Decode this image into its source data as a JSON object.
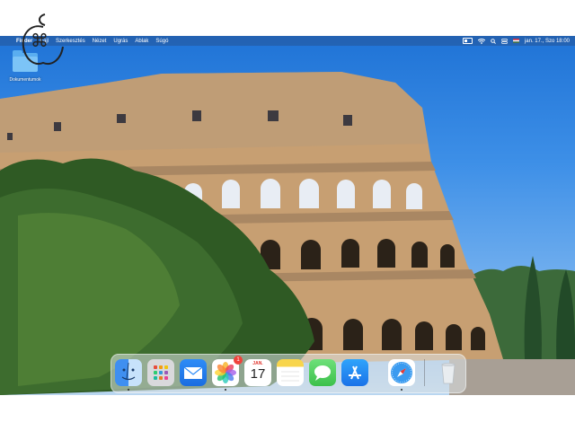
{
  "menubar": {
    "app_menu": "Finder",
    "items": [
      "Fájl",
      "Szerkesztés",
      "Nézet",
      "Ugrás",
      "Ablak",
      "Súgó"
    ],
    "clock": "jan. 17., Szo 18:00"
  },
  "desktop": {
    "folder_label": "Dokumentumok"
  },
  "dock": {
    "apps": [
      "Finder",
      "Launchpad",
      "Mail",
      "Photos",
      "Calendar",
      "Notes",
      "Messages",
      "App Store",
      "Safari",
      "Trash"
    ],
    "photos_badge": "1",
    "calendar_month": "JAN.",
    "calendar_day": "17"
  },
  "icons": [
    "apple-logo-icon",
    "battery-icon",
    "wifi-icon",
    "search-icon",
    "control-center-icon",
    "flag-icon",
    "folder-icon"
  ]
}
